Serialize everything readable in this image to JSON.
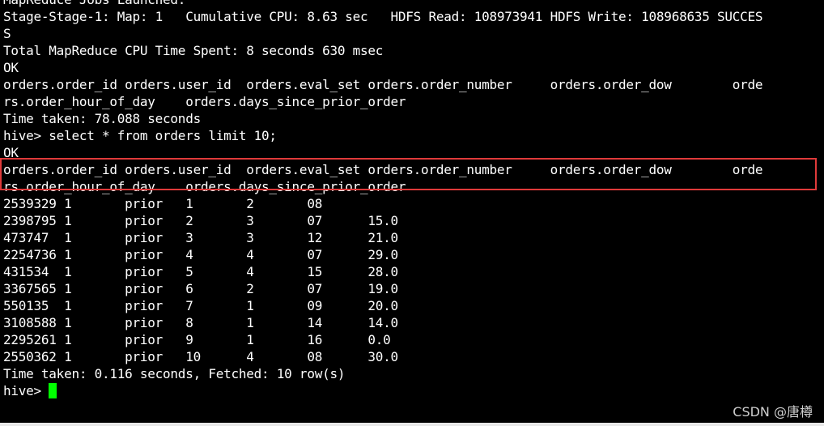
{
  "terminal": {
    "lines": [
      "MapReduce Jobs Launched:",
      "Stage-Stage-1: Map: 1   Cumulative CPU: 8.63 sec   HDFS Read: 108973941 HDFS Write: 108968635 SUCCES",
      "S",
      "Total MapReduce CPU Time Spent: 8 seconds 630 msec",
      "OK",
      "orders.order_id orders.user_id  orders.eval_set orders.order_number     orders.order_dow        orde",
      "rs.order_hour_of_day    orders.days_since_prior_order",
      "Time taken: 78.088 seconds",
      "hive> select * from orders limit 10;",
      "OK",
      "orders.order_id orders.user_id  orders.eval_set orders.order_number     orders.order_dow        orde",
      "rs.order_hour_of_day    orders.days_since_prior_order",
      "2539329 1       prior   1       2       08",
      "2398795 1       prior   2       3       07      15.0",
      "473747  1       prior   3       3       12      21.0",
      "2254736 1       prior   4       4       07      29.0",
      "431534  1       prior   5       4       15      28.0",
      "3367565 1       prior   6       2       07      19.0",
      "550135  1       prior   7       1       09      20.0",
      "3108588 1       prior   8       1       14      14.0",
      "2295261 1       prior   9       1       16      0.0",
      "2550362 1       prior   10      4       08      30.0",
      "Time taken: 0.116 seconds, Fetched: 10 row(s)",
      "hive> "
    ]
  },
  "watermark": "CSDN @唐樽",
  "colors": {
    "background": "#000000",
    "text": "#ffffff",
    "cursor": "#00ff00",
    "highlight_border": "#e03a3a"
  }
}
